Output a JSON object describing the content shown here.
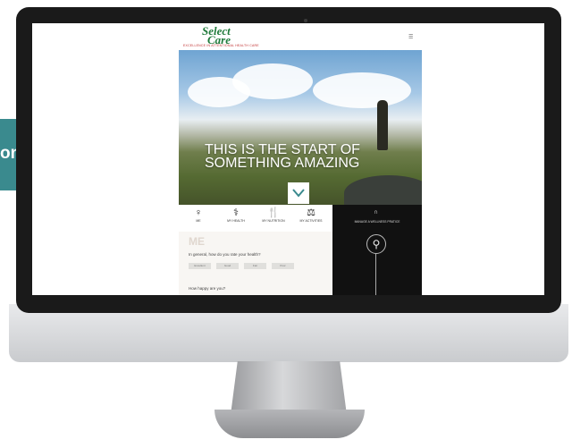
{
  "callout": {
    "text": "on",
    "color": "#3a8a8e"
  },
  "site": {
    "logo_line1": "Select",
    "logo_line2": "Care",
    "logo_tagline": "EXCELLENCE IN ATTENTIONAL HEALTH CARE",
    "menu_icon": "menu-icon"
  },
  "hero": {
    "title_line1": "THIS IS THE START OF",
    "title_line2": "SOMETHING AMAZING",
    "scroll_icon": "chevron-down-icon"
  },
  "nav": {
    "items": [
      {
        "label": "ME",
        "icon": "person-icon",
        "glyph": "♀"
      },
      {
        "label": "MY HEALTH",
        "icon": "health-icon",
        "glyph": "⚕"
      },
      {
        "label": "MY NUTRITION",
        "icon": "fork-knife-icon",
        "glyph": "🍴"
      },
      {
        "label": "MY ACTIVITIES",
        "icon": "activity-icon",
        "glyph": "⚖"
      }
    ]
  },
  "me_panel": {
    "heading": "ME",
    "question1": "In general, how do you rate your health?",
    "options": [
      "Excellent",
      "Good",
      "Fair",
      "Poor"
    ],
    "question2": "How happy are you?"
  },
  "right_panel": {
    "title": "MANAGE A WELLNESS PRATICE",
    "icon": "vitruvian-man-icon",
    "glyph": "⚲"
  },
  "device": {
    "apple_glyph": ""
  }
}
